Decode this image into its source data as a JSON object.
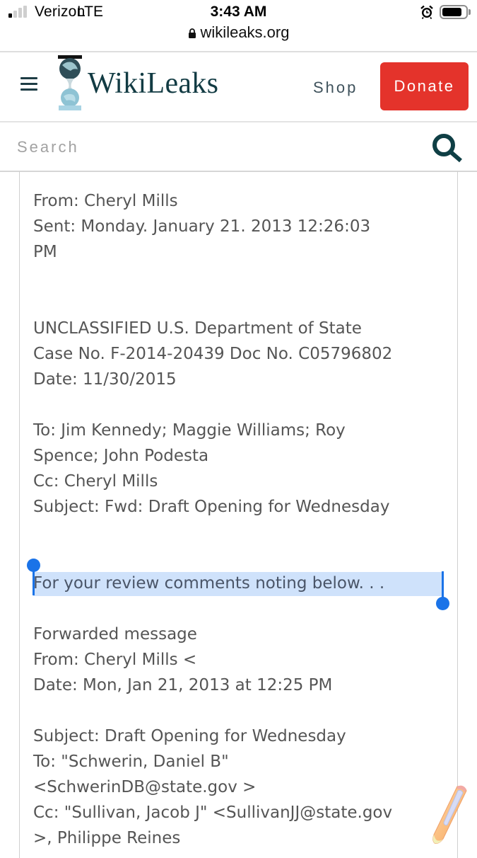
{
  "status_bar": {
    "signal_bars": 1,
    "signal_bars_total": 4,
    "carrier": "Verizon",
    "network": "LTE",
    "time": "3:43 AM",
    "alarm_icon": "alarm-clock-icon",
    "battery_level_percent": 85,
    "url": "wikileaks.org",
    "lock_icon": "lock-icon"
  },
  "header": {
    "menu_icon": "hamburger-menu-icon",
    "logo_icon": "wikileaks-hourglass-logo",
    "logo_text": "WikiLeaks",
    "shop_label": "Shop",
    "donate_label": "Donate",
    "colors": {
      "brand": "#123b43",
      "donate": "#e4332b"
    }
  },
  "search": {
    "placeholder": "Search",
    "value": "",
    "icon": "search-icon"
  },
  "document": {
    "from": "From: Cheryl Mills",
    "sent_line1": "Sent: Monday. January 21. 2013 12:26:03",
    "sent_line2": "PM",
    "classification": "UNCLASSIFIED U.S. Department of State",
    "case_line": "Case No. F-2014-20439 Doc No. C05796802",
    "date": "Date: 11/30/2015",
    "to_line1": "To: Jim Kennedy; Maggie Williams; Roy",
    "to_line2": "Spence; John Podesta",
    "cc": "Cc: Cheryl Mills",
    "subject": "Subject: Fwd: Draft Opening for Wednesday",
    "selected_text": "For your review comments noting below. . .",
    "forwarded_header": "Forwarded message",
    "fwd_from": "From: Cheryl Mills <",
    "fwd_date": "Date: Mon, Jan 21, 2013 at 12:25 PM",
    "fwd_subject": "Subject: Draft Opening for Wednesday",
    "fwd_to_line1": "To: \"Schwerin, Daniel B\"",
    "fwd_to_line2": "<SchwerinDB@state.gov >",
    "fwd_cc_line1": "Cc: \"Sullivan, Jacob J\" <SullivanJJ@state.gov",
    "fwd_cc_line2": ">, Philippe Reines"
  },
  "overlay": {
    "pencil_icon": "markup-pencil-icon",
    "selection_color": "#1a73e8"
  }
}
